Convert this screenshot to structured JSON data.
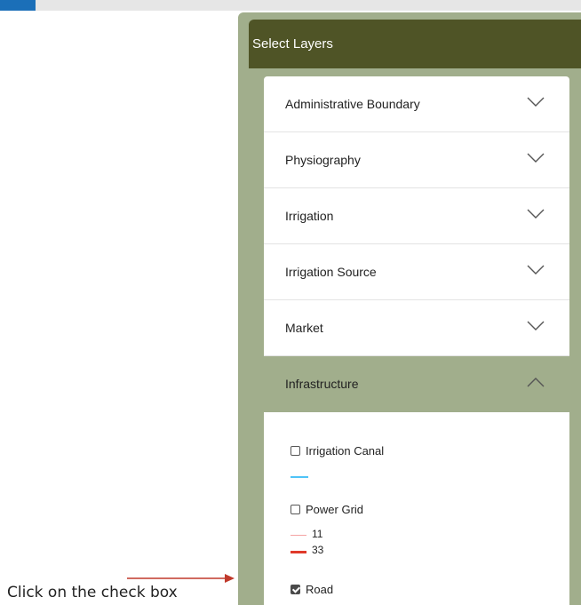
{
  "panel": {
    "title": "Select Layers",
    "sections": [
      {
        "label": "Administrative Boundary",
        "expanded": false,
        "icon": "chevron-down-icon"
      },
      {
        "label": "Physiography",
        "expanded": false,
        "icon": "chevron-down-icon"
      },
      {
        "label": "Irrigation",
        "expanded": false,
        "icon": "chevron-down-icon"
      },
      {
        "label": "Irrigation Source",
        "expanded": false,
        "icon": "chevron-down-icon"
      },
      {
        "label": "Market",
        "expanded": false,
        "icon": "chevron-down-icon"
      },
      {
        "label": "Infrastructure",
        "expanded": true,
        "icon": "chevron-up-icon"
      }
    ],
    "infrastructure_layers": [
      {
        "label": "Irrigation Canal",
        "checked": false,
        "legend": [
          {
            "value": "",
            "color": "#4fc3f7"
          }
        ]
      },
      {
        "label": "Power Grid",
        "checked": false,
        "legend": [
          {
            "value": "11",
            "color": "#f4a3a3"
          },
          {
            "value": "33",
            "color": "#e03a2a"
          }
        ]
      },
      {
        "label": "Road",
        "checked": true
      }
    ]
  },
  "annotation": {
    "text": "Click on the check box",
    "arrow_color": "#c0392b"
  },
  "colors": {
    "header_bg": "#4f5426",
    "panel_bg": "#a1ae8c",
    "active_section_bg": "#a1ae8c",
    "top_accent": "#1b6fb8"
  }
}
